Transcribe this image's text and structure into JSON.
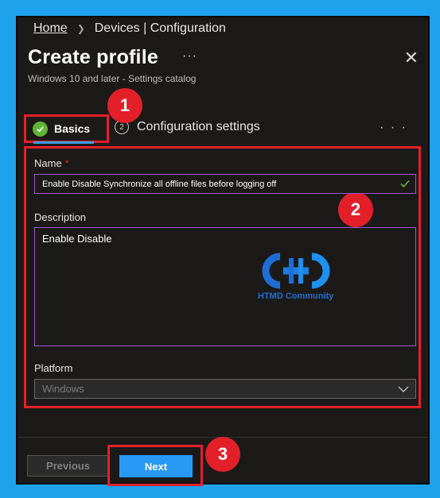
{
  "breadcrumb": {
    "home": "Home",
    "current": "Devices | Configuration"
  },
  "header": {
    "title": "Create profile",
    "title_more": "···",
    "close": "✕",
    "subtitle": "Windows 10 and later - Settings catalog"
  },
  "tabs": [
    {
      "label": "Basics",
      "state": "complete"
    },
    {
      "label": "Configuration settings",
      "step": "2"
    }
  ],
  "more_menu": "· · ·",
  "annotations": [
    "1",
    "2",
    "3"
  ],
  "form": {
    "name_label": "Name",
    "name_required": "*",
    "name_value": "Enable Disable Synchronize all offline files before logging off",
    "description_label": "Description",
    "description_value": "Enable Disable",
    "platform_label": "Platform",
    "platform_value": "Windows"
  },
  "watermark": {
    "text": "HTMD Community"
  },
  "footer": {
    "previous": "Previous",
    "next": "Next"
  },
  "colors": {
    "background": "#1fa2ec",
    "panel": "#1b1a19",
    "highlight": "#e3202a",
    "accent": "#2899f5",
    "success": "#5fb636",
    "input_border": "#a256c9"
  }
}
